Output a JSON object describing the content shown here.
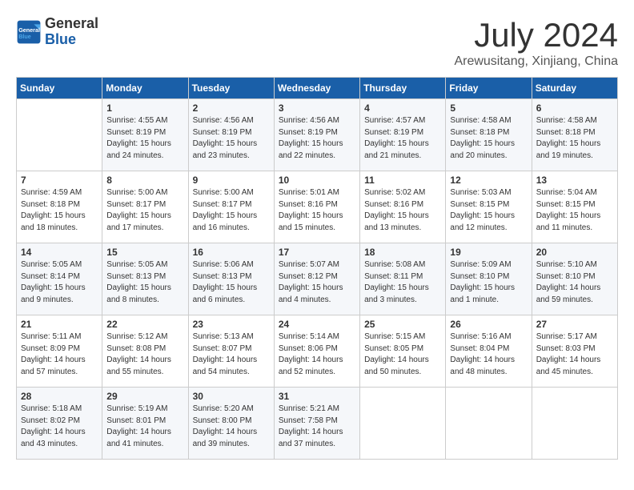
{
  "header": {
    "logo_line1": "General",
    "logo_line2": "Blue",
    "month": "July 2024",
    "location": "Arewusitang, Xinjiang, China"
  },
  "weekdays": [
    "Sunday",
    "Monday",
    "Tuesday",
    "Wednesday",
    "Thursday",
    "Friday",
    "Saturday"
  ],
  "weeks": [
    [
      {
        "day": "",
        "info": ""
      },
      {
        "day": "1",
        "info": "Sunrise: 4:55 AM\nSunset: 8:19 PM\nDaylight: 15 hours\nand 24 minutes."
      },
      {
        "day": "2",
        "info": "Sunrise: 4:56 AM\nSunset: 8:19 PM\nDaylight: 15 hours\nand 23 minutes."
      },
      {
        "day": "3",
        "info": "Sunrise: 4:56 AM\nSunset: 8:19 PM\nDaylight: 15 hours\nand 22 minutes."
      },
      {
        "day": "4",
        "info": "Sunrise: 4:57 AM\nSunset: 8:19 PM\nDaylight: 15 hours\nand 21 minutes."
      },
      {
        "day": "5",
        "info": "Sunrise: 4:58 AM\nSunset: 8:18 PM\nDaylight: 15 hours\nand 20 minutes."
      },
      {
        "day": "6",
        "info": "Sunrise: 4:58 AM\nSunset: 8:18 PM\nDaylight: 15 hours\nand 19 minutes."
      }
    ],
    [
      {
        "day": "7",
        "info": "Sunrise: 4:59 AM\nSunset: 8:18 PM\nDaylight: 15 hours\nand 18 minutes."
      },
      {
        "day": "8",
        "info": "Sunrise: 5:00 AM\nSunset: 8:17 PM\nDaylight: 15 hours\nand 17 minutes."
      },
      {
        "day": "9",
        "info": "Sunrise: 5:00 AM\nSunset: 8:17 PM\nDaylight: 15 hours\nand 16 minutes."
      },
      {
        "day": "10",
        "info": "Sunrise: 5:01 AM\nSunset: 8:16 PM\nDaylight: 15 hours\nand 15 minutes."
      },
      {
        "day": "11",
        "info": "Sunrise: 5:02 AM\nSunset: 8:16 PM\nDaylight: 15 hours\nand 13 minutes."
      },
      {
        "day": "12",
        "info": "Sunrise: 5:03 AM\nSunset: 8:15 PM\nDaylight: 15 hours\nand 12 minutes."
      },
      {
        "day": "13",
        "info": "Sunrise: 5:04 AM\nSunset: 8:15 PM\nDaylight: 15 hours\nand 11 minutes."
      }
    ],
    [
      {
        "day": "14",
        "info": "Sunrise: 5:05 AM\nSunset: 8:14 PM\nDaylight: 15 hours\nand 9 minutes."
      },
      {
        "day": "15",
        "info": "Sunrise: 5:05 AM\nSunset: 8:13 PM\nDaylight: 15 hours\nand 8 minutes."
      },
      {
        "day": "16",
        "info": "Sunrise: 5:06 AM\nSunset: 8:13 PM\nDaylight: 15 hours\nand 6 minutes."
      },
      {
        "day": "17",
        "info": "Sunrise: 5:07 AM\nSunset: 8:12 PM\nDaylight: 15 hours\nand 4 minutes."
      },
      {
        "day": "18",
        "info": "Sunrise: 5:08 AM\nSunset: 8:11 PM\nDaylight: 15 hours\nand 3 minutes."
      },
      {
        "day": "19",
        "info": "Sunrise: 5:09 AM\nSunset: 8:10 PM\nDaylight: 15 hours\nand 1 minute."
      },
      {
        "day": "20",
        "info": "Sunrise: 5:10 AM\nSunset: 8:10 PM\nDaylight: 14 hours\nand 59 minutes."
      }
    ],
    [
      {
        "day": "21",
        "info": "Sunrise: 5:11 AM\nSunset: 8:09 PM\nDaylight: 14 hours\nand 57 minutes."
      },
      {
        "day": "22",
        "info": "Sunrise: 5:12 AM\nSunset: 8:08 PM\nDaylight: 14 hours\nand 55 minutes."
      },
      {
        "day": "23",
        "info": "Sunrise: 5:13 AM\nSunset: 8:07 PM\nDaylight: 14 hours\nand 54 minutes."
      },
      {
        "day": "24",
        "info": "Sunrise: 5:14 AM\nSunset: 8:06 PM\nDaylight: 14 hours\nand 52 minutes."
      },
      {
        "day": "25",
        "info": "Sunrise: 5:15 AM\nSunset: 8:05 PM\nDaylight: 14 hours\nand 50 minutes."
      },
      {
        "day": "26",
        "info": "Sunrise: 5:16 AM\nSunset: 8:04 PM\nDaylight: 14 hours\nand 48 minutes."
      },
      {
        "day": "27",
        "info": "Sunrise: 5:17 AM\nSunset: 8:03 PM\nDaylight: 14 hours\nand 45 minutes."
      }
    ],
    [
      {
        "day": "28",
        "info": "Sunrise: 5:18 AM\nSunset: 8:02 PM\nDaylight: 14 hours\nand 43 minutes."
      },
      {
        "day": "29",
        "info": "Sunrise: 5:19 AM\nSunset: 8:01 PM\nDaylight: 14 hours\nand 41 minutes."
      },
      {
        "day": "30",
        "info": "Sunrise: 5:20 AM\nSunset: 8:00 PM\nDaylight: 14 hours\nand 39 minutes."
      },
      {
        "day": "31",
        "info": "Sunrise: 5:21 AM\nSunset: 7:58 PM\nDaylight: 14 hours\nand 37 minutes."
      },
      {
        "day": "",
        "info": ""
      },
      {
        "day": "",
        "info": ""
      },
      {
        "day": "",
        "info": ""
      }
    ]
  ]
}
